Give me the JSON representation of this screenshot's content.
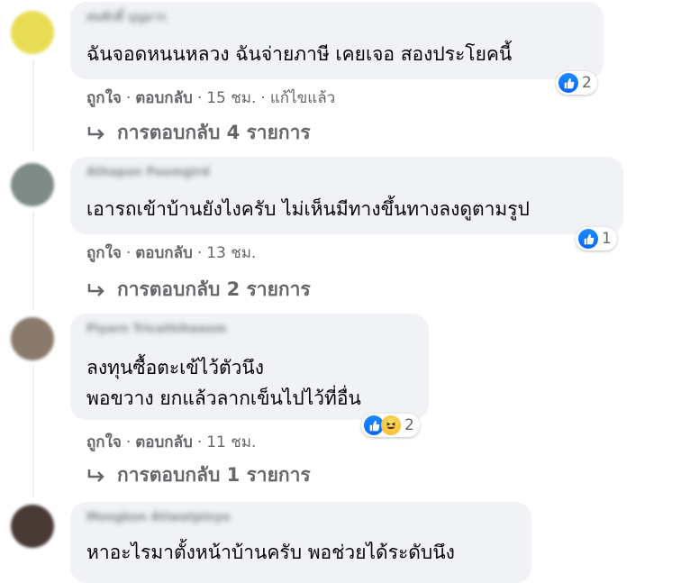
{
  "comments": [
    {
      "author": "สมศักดิ์ บุญมาก",
      "lines": [
        "ฉันจอดหนนหลวง ฉันจ่ายภาษี เคยเจอ สองประโยคนี้"
      ],
      "reaction_icons": [
        "like-icon"
      ],
      "reaction_count": "2",
      "like_label": "ถูกใจ",
      "reply_label": "ตอบกลับ",
      "time": "15 ชม.",
      "edited": "แก้ไขแล้ว",
      "replies_label": "การตอบกลับ 4 รายการ",
      "avatar_color": "#e9dc55"
    },
    {
      "author": "Athapon Poomgird",
      "lines": [
        "เอารถเข้าบ้านยังไงครับ ไม่เห็นมีทางขึ้นทางลงดูตามรูป"
      ],
      "reaction_icons": [
        "like-icon"
      ],
      "reaction_count": "1",
      "like_label": "ถูกใจ",
      "reply_label": "ตอบกลับ",
      "time": "13 ชม.",
      "replies_label": "การตอบกลับ 2 รายการ",
      "avatar_color": "#7d8a85"
    },
    {
      "author": "Piyarn Tricathiheeom",
      "lines": [
        "ลงทุนซื้อตะเข้ไว้ตัวนึง",
        "พอขวาง ยกแล้วลากเข็นไปไว้ที่อื่น"
      ],
      "reaction_icons": [
        "like-icon",
        "haha-icon"
      ],
      "reaction_count": "2",
      "like_label": "ถูกใจ",
      "reply_label": "ตอบกลับ",
      "time": "11 ชม.",
      "replies_label": "การตอบกลับ 1 รายการ",
      "avatar_color": "#8a7a6c"
    },
    {
      "author": "Mongkon Atiwatpinyo",
      "lines": [
        "หาอะไรมาตั้งหน้าบ้านครับ พอช่วยได้ระดับนึง"
      ],
      "avatar_color": "#4a3a35"
    }
  ],
  "colors": {
    "bubble": "#f0f2f5",
    "meta_text": "#65676b",
    "like_blue": "#0866ff",
    "haha_yellow": "#f7b125"
  }
}
